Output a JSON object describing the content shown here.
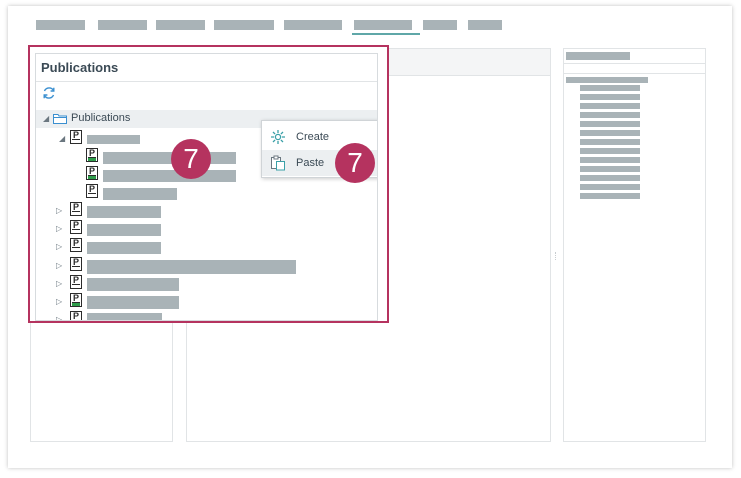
{
  "publications_panel": {
    "title": "Publications",
    "tree": {
      "root_label": "Publications"
    }
  },
  "context_menu": {
    "create_label": "Create",
    "paste_label": "Paste"
  },
  "callouts": {
    "tree_badge": "7",
    "menu_badge": "7"
  },
  "icons": {
    "refresh": "refresh-icon",
    "folder": "folder-icon",
    "publication": "publication-icon",
    "create": "gear-icon",
    "paste": "paste-icon"
  },
  "colors": {
    "highlight": "#b5335f",
    "accent": "#5fa7a8",
    "placeholder": "#a9b3b7",
    "published": "#2e9d4a"
  }
}
